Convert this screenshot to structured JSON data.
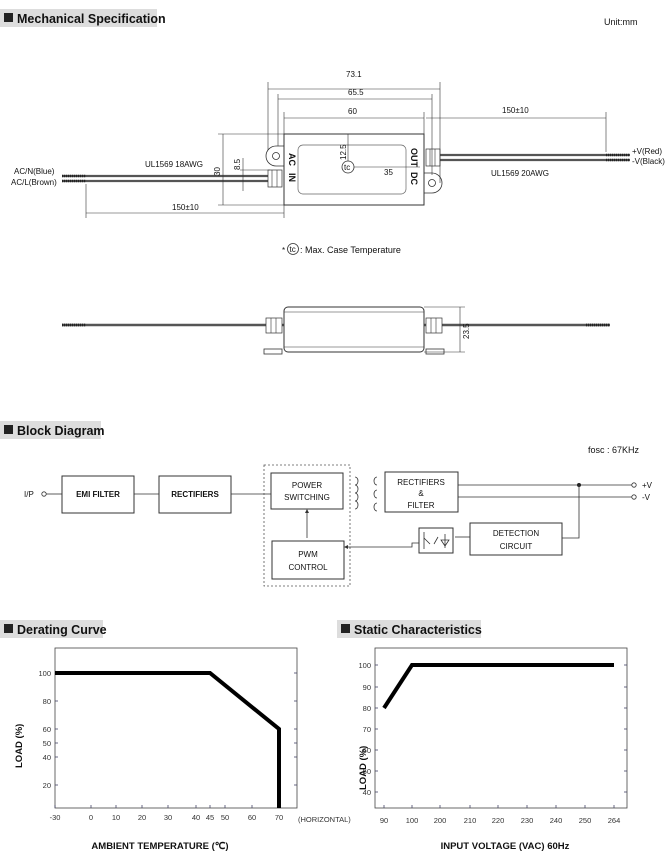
{
  "sections": {
    "mechanical": "Mechanical Specification",
    "block": "Block Diagram",
    "derating": "Derating Curve",
    "static": "Static Characteristics"
  },
  "mechanical": {
    "unit": "Unit:mm",
    "dims": {
      "d73": "73.1",
      "d65": "65.5",
      "d60": "60",
      "d150r": "150±10",
      "d150l": "150±10",
      "d30": "30",
      "d8": "8.5",
      "d12": "12.5",
      "d35": "35",
      "d23": "23.5"
    },
    "wires": {
      "acn": "AC/N(Blue)",
      "acl": "AC/L(Brown)",
      "vp": "+V(Red)",
      "vn": "-V(Black)",
      "in_awg": "UL1569  18AWG",
      "out_awg": "UL1569  20AWG"
    },
    "labels": {
      "ac": "AC",
      "in": "IN",
      "dc": "DC",
      "out": "OUT",
      "tc": "tc"
    },
    "note": ": Max. Case Temperature",
    "note_star": "*"
  },
  "block": {
    "fosc": "fosc : 67KHz",
    "ip": "I/P",
    "emi": "EMI FILTER",
    "rect": "RECTIFIERS",
    "psw1": "POWER",
    "psw2": "SWITCHING",
    "pwm1": "PWM",
    "pwm2": "CONTROL",
    "rf1": "RECTIFIERS",
    "rf2": "&",
    "rf3": "FILTER",
    "det1": "DETECTION",
    "det2": "CIRCUIT",
    "vp": "+V",
    "vn": "-V"
  },
  "chart_data": [
    {
      "type": "line",
      "xlabel": "AMBIENT TEMPERATURE (℃)",
      "ylabel": "LOAD (%)",
      "x_ticks": [
        "-30",
        "0",
        "10",
        "20",
        "30",
        "40",
        "45",
        "50",
        "60",
        "70"
      ],
      "x_note": "(HORIZONTAL)",
      "y_ticks": [
        "100",
        "80",
        "60",
        "50",
        "40",
        "20"
      ],
      "xlim": [
        -30,
        70
      ],
      "ylim": [
        0,
        100
      ],
      "x": [
        -30,
        45,
        70,
        70
      ],
      "y": [
        100,
        100,
        60,
        0
      ]
    },
    {
      "type": "line",
      "xlabel": "INPUT VOLTAGE (VAC) 60Hz",
      "ylabel": "LOAD (%)",
      "x_ticks": [
        "90",
        "100",
        "200",
        "210",
        "220",
        "230",
        "240",
        "250",
        "264"
      ],
      "y_ticks": [
        "100",
        "90",
        "80",
        "70",
        "60",
        "50",
        "40"
      ],
      "ylim": [
        30,
        100
      ],
      "x": [
        90,
        100,
        264
      ],
      "y": [
        80,
        100,
        100
      ]
    }
  ]
}
